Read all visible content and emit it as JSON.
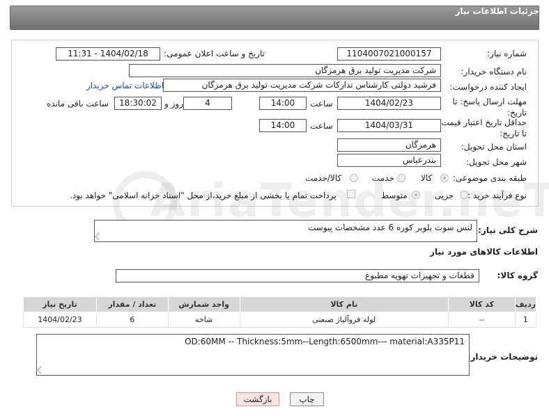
{
  "header": {
    "title": "جزئیات اطلاعات نیاز"
  },
  "form": {
    "need_number_label": "شماره نیاز:",
    "need_number": "1104007021000157",
    "announce_label": "تاریخ و ساعت اعلان عمومی:",
    "announce_value": "1404/02/18 - 11:31",
    "buyer_org_label": "نام دستگاه خریدار:",
    "buyer_org": "شرکت مدیریت تولید برق هرمزگان",
    "creator_label": "ایجاد کننده درخواست:",
    "creator": "فرشید دولتی کارشناس تدارکات شرکت مدیریت تولید برق هرمزگان",
    "contact_link": "اطلاعات تماس خریدار",
    "reply_deadline_label": "مهلت ارسال پاسخ: تا تاریخ:",
    "reply_date": "1404/02/23",
    "time_label": "ساعت",
    "reply_time": "14:00",
    "days_value": "4",
    "days_label": "روز و",
    "remaining_time": "18:30:02",
    "remaining_label": "ساعت باقی مانده",
    "price_validity_label": "حداقل تاریخ اعتبار قیمت: تا تاریخ:",
    "validity_date": "1404/03/31",
    "validity_time": "14:00",
    "province_label": "استان محل تحویل:",
    "province": "هرمزگان",
    "city_label": "شهر محل تحویل:",
    "city": "بندرعباس",
    "category_label": "طبقه بندی موضوعی:",
    "category_options": [
      "کالا",
      "خدمت",
      "کالا/خدمت"
    ],
    "category_selected": "کالا",
    "process_label": "نوع فرآیند خرید :",
    "process_options": [
      "جزیی",
      "متوسط"
    ],
    "process_selected": "متوسط",
    "payment_note": "پرداخت تمام یا بخشی از مبلغ خرید،از محل \"اسناد خزانه اسلامی\" خواهد بود."
  },
  "summary": {
    "label": "شرح کلی نیاز:",
    "value": "لنس سوت بلوبر کوره 6 عدد مشخصات پیوست"
  },
  "goods_section": {
    "title": "اطلاعات کالاهای مورد نیاز",
    "group_label": "گروه کالا:",
    "group_value": "قطعات و تجهیزات تهویه مطبوع",
    "columns": [
      "ردیف",
      "کد کالا",
      "نام کالا",
      "واحد شمارش",
      "تعداد / مقدار",
      "تاریخ نیاز"
    ],
    "rows": [
      [
        "1",
        "--",
        "لوله فروآلیاژ صنعتی",
        "شاخه",
        "6",
        "1404/02/23"
      ]
    ]
  },
  "buyer_notes": {
    "label": "توضیحات خریدار:",
    "value": "OD:60MM -- Thickness:5mm--Length:6500mm--- material:A335P11"
  },
  "buttons": {
    "print": "چاپ",
    "back": "بازگشت"
  },
  "watermark": "AriaTender.neT",
  "colors": {
    "header_bg": "#7f7f7f",
    "link": "#1a4fa0",
    "table_header": "#d6d6d6",
    "back_button": "#f8e3e3"
  }
}
